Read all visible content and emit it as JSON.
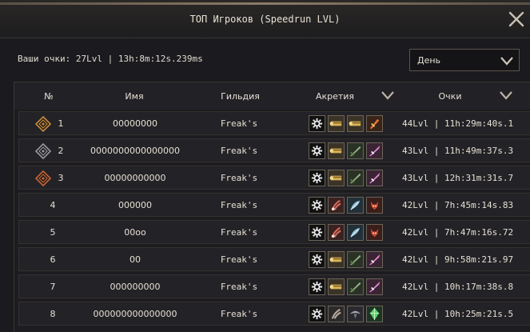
{
  "window": {
    "title": "ТОП Игроков (Speedrun LVL)"
  },
  "my_score": "Ваши очки: 27Lvl | 13h:8m:12s.239ms",
  "period": {
    "selected": "День"
  },
  "columns": {
    "rank": "№",
    "name": "Имя",
    "guild": "Гильдия",
    "accretion": "Акретия",
    "score": "Очки"
  },
  "colors": {
    "gold": "#c98b3e",
    "silver": "#9a9aa2",
    "bronze": "#c7673a",
    "accent": "#8c7c66"
  },
  "rows": [
    {
      "rank": "1",
      "medal": "gold",
      "name": "00000000",
      "guild": "Freak's",
      "icons": [
        "rune-icon",
        "scroll-gold-icon",
        "scroll-gold-icon",
        "dagger-orange-icon"
      ],
      "score": "44Lvl | 11h:29m:40s.1"
    },
    {
      "rank": "2",
      "medal": "silver",
      "name": "0000000000000000",
      "guild": "Freak's",
      "icons": [
        "rune-icon",
        "scroll-gold-icon",
        "blade-green-icon",
        "sword-pink-icon"
      ],
      "score": "43Lvl | 11h:49m:37s.3"
    },
    {
      "rank": "3",
      "medal": "bronze",
      "name": "00000000000",
      "guild": "Freak's",
      "icons": [
        "rune-icon",
        "scroll-gold-icon",
        "blade-green-icon",
        "sword-pink-icon"
      ],
      "score": "43Lvl | 12h:31m:31s.7"
    },
    {
      "rank": "4",
      "medal": "",
      "name": "000000",
      "guild": "Freak's",
      "icons": [
        "rune-icon",
        "claw-red-icon",
        "feather-blue-icon",
        "demon-red-icon"
      ],
      "score": "42Lvl | 7h:45m:14s.83"
    },
    {
      "rank": "5",
      "medal": "",
      "name": "00oo",
      "guild": "Freak's",
      "icons": [
        "rune-icon",
        "claw-red-icon",
        "feather-blue-icon",
        "demon-red-icon"
      ],
      "score": "42Lvl | 7h:47m:16s.72"
    },
    {
      "rank": "6",
      "medal": "",
      "name": "00",
      "guild": "Freak's",
      "icons": [
        "rune-icon",
        "scroll-gold-icon",
        "blade-green-icon",
        "sword-pink-icon"
      ],
      "score": "42Lvl | 9h:58m:21s.97"
    },
    {
      "rank": "7",
      "medal": "",
      "name": "000000000",
      "guild": "Freak's",
      "icons": [
        "rune-icon",
        "scroll-gold-icon",
        "blade-green-icon",
        "sword-pink-icon"
      ],
      "score": "42Lvl | 10h:17m:38s.8"
    },
    {
      "rank": "8",
      "medal": "",
      "name": "000000000000000",
      "guild": "Freak's",
      "icons": [
        "rune-icon",
        "claw-grey-icon",
        "bird-grey-icon",
        "crystal-green-icon"
      ],
      "score": "42Lvl | 10h:25m:21s.5"
    }
  ]
}
